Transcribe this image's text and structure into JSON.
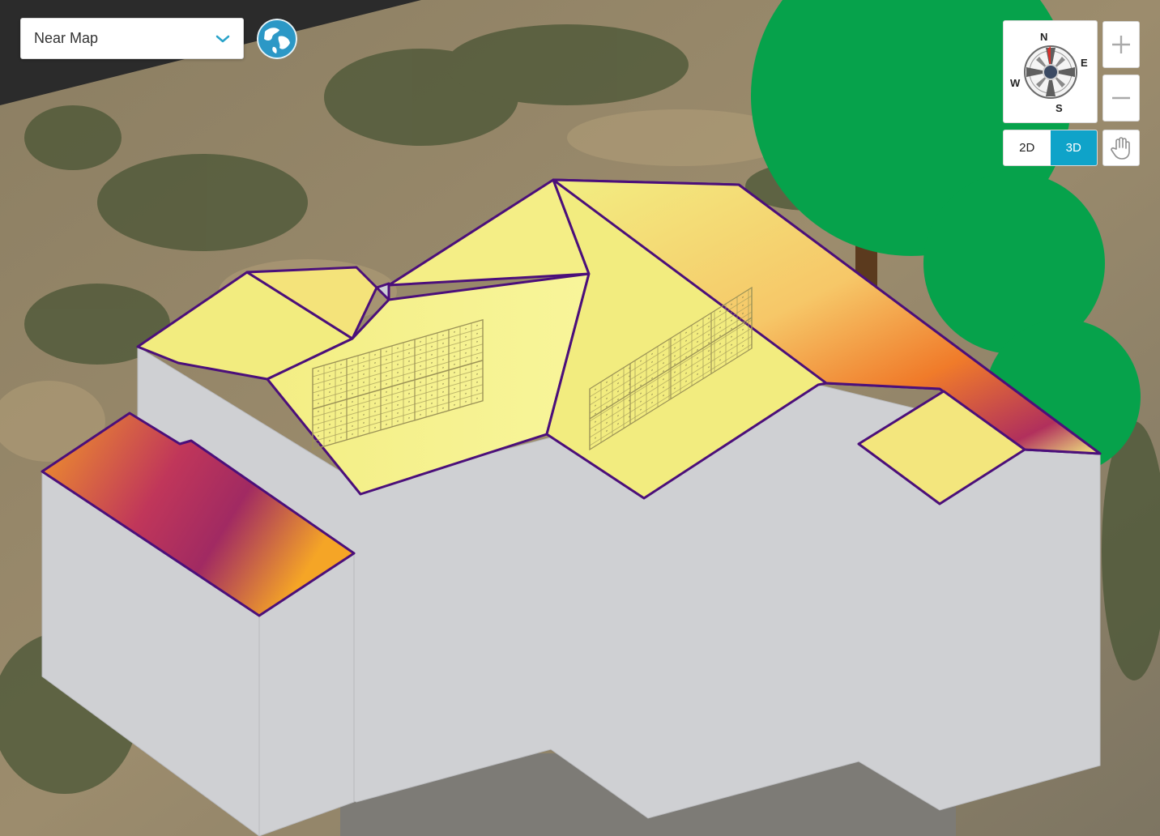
{
  "map": {
    "layer_selector": {
      "value": "Near Map",
      "icon": "chevron-down-icon"
    },
    "globe": {
      "icon": "globe-icon"
    }
  },
  "compass": {
    "n": "N",
    "e": "E",
    "s": "S",
    "w": "W",
    "icon": "compass-icon"
  },
  "zoom": {
    "in_icon": "plus-icon",
    "out_icon": "minus-icon"
  },
  "view": {
    "mode_2d": "2D",
    "mode_3d": "3D",
    "active": "3D",
    "pan_icon": "hand-icon"
  },
  "colors": {
    "accent": "#0fa3c9",
    "roof_outline": "#4b0f7a",
    "roof_low": "#f2ee82",
    "roof_high_mid": "#f2a12b",
    "roof_high": "#a82660",
    "wall": "#cfd0d3",
    "tree_canopy": "#06a24b",
    "tree_trunk": "#5b3a1e"
  }
}
